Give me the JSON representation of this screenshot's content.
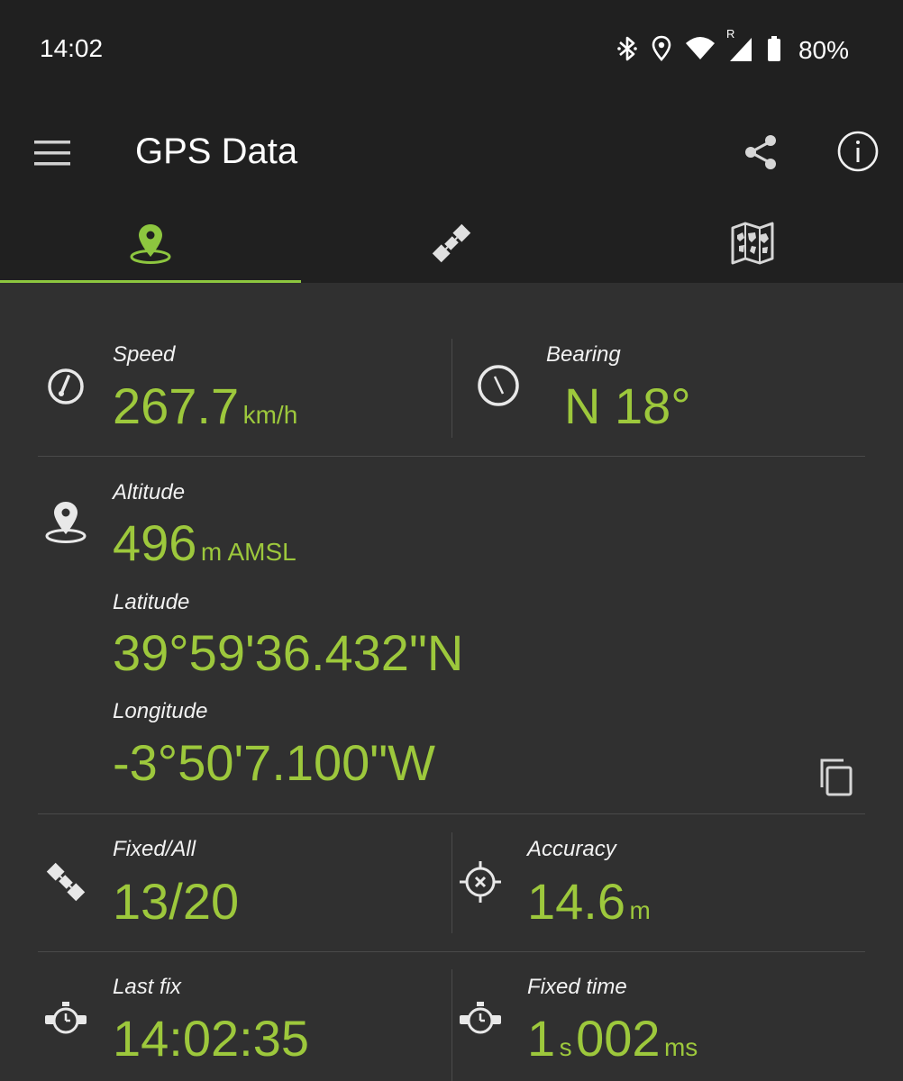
{
  "status_bar": {
    "time": "14:02",
    "icons": [
      "bluetooth-icon",
      "location-icon",
      "wifi-icon",
      "signal-icon",
      "battery-icon"
    ],
    "roaming_indicator": "R",
    "battery_percent": "80%"
  },
  "app_bar": {
    "title": "GPS Data",
    "menu_icon": "hamburger-menu-icon",
    "actions": [
      "share-icon",
      "info-icon"
    ]
  },
  "tabs": [
    {
      "icon": "location-pin-icon",
      "selected": true
    },
    {
      "icon": "satellite-icon",
      "selected": false
    },
    {
      "icon": "world-map-icon",
      "selected": false
    }
  ],
  "colors": {
    "accent": "#8dc63f",
    "value_text": "#9dc83c",
    "background": "#303030",
    "bar_background": "#202020"
  },
  "metrics": {
    "speed": {
      "label": "Speed",
      "value": "267.7",
      "unit": "km/h",
      "icon": "speedometer-icon"
    },
    "bearing": {
      "label": "Bearing",
      "value": "N 18°",
      "icon": "compass-icon"
    },
    "altitude": {
      "label": "Altitude",
      "value": "496",
      "unit": "m AMSL",
      "icon": "location-pin-icon"
    },
    "latitude": {
      "label": "Latitude",
      "value": "39°59'36.432\"N"
    },
    "longitude": {
      "label": "Longitude",
      "value": "-3°50'7.100\"W"
    },
    "fixed_all": {
      "label": "Fixed/All",
      "value": "13/20",
      "icon": "satellite-icon"
    },
    "accuracy": {
      "label": "Accuracy",
      "value": "14.6",
      "unit": "m",
      "icon": "crosshair-icon"
    },
    "last_fix": {
      "label": "Last fix",
      "value": "14:02:35",
      "icon": "stopwatch-icon"
    },
    "fixed_time": {
      "label": "Fixed time",
      "seconds": "1",
      "seconds_unit": "s",
      "millis": "002",
      "millis_unit": "ms",
      "icon": "stopwatch-icon"
    }
  },
  "copy_icon": "copy-icon"
}
